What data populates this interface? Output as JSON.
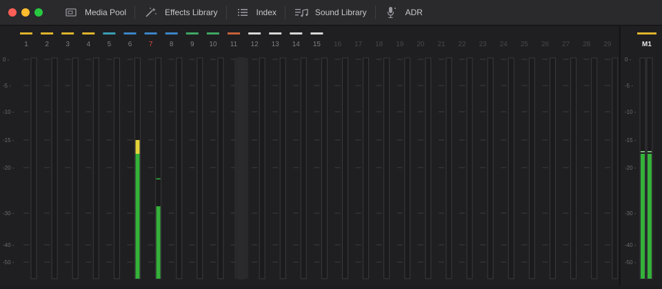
{
  "window": {
    "title": ""
  },
  "toolbar": {
    "items": [
      {
        "label": "Media Pool",
        "icon": "media-pool-icon"
      },
      {
        "label": "Effects Library",
        "icon": "effects-library-icon"
      },
      {
        "label": "Index",
        "icon": "index-icon"
      },
      {
        "label": "Sound Library",
        "icon": "sound-library-icon"
      },
      {
        "label": "ADR",
        "icon": "adr-microphone-icon"
      }
    ]
  },
  "meters": {
    "scale": [
      {
        "label": "0 -",
        "db": 0
      },
      {
        "label": "-5 -",
        "db": -5
      },
      {
        "label": "-10 -",
        "db": -10
      },
      {
        "label": "-15 -",
        "db": -15
      },
      {
        "label": "-20 -",
        "db": -20
      },
      {
        "label": "-30 -",
        "db": -30
      },
      {
        "label": "-40 -",
        "db": -40
      },
      {
        "label": "-50 -",
        "db": -50
      }
    ],
    "channels": [
      {
        "label": "1",
        "color": "#e0b52c",
        "active": true
      },
      {
        "label": "2",
        "color": "#e0b52c",
        "active": true
      },
      {
        "label": "3",
        "color": "#e0b52c",
        "active": true
      },
      {
        "label": "4",
        "color": "#e0b52c",
        "active": true
      },
      {
        "label": "5",
        "color": "#3aa0b8",
        "active": true
      },
      {
        "label": "6",
        "color": "#3c86c8",
        "active": true,
        "level": -17.5,
        "peak": -15,
        "hold": -15
      },
      {
        "label": "7",
        "color": "#3c86c8",
        "active": true,
        "selected": true,
        "level": -28.5,
        "hold": -22.5
      },
      {
        "label": "8",
        "color": "#3c86c8",
        "active": true
      },
      {
        "label": "9",
        "color": "#3fa863",
        "active": true
      },
      {
        "label": "10",
        "color": "#3fa863",
        "active": true
      },
      {
        "label": "11",
        "color": "#c8623a",
        "active": true,
        "disabled": true
      },
      {
        "label": "12",
        "color": "#d8d8d8",
        "active": true
      },
      {
        "label": "13",
        "color": "#d8d8d8",
        "active": true
      },
      {
        "label": "14",
        "color": "#d8d8d8",
        "active": true
      },
      {
        "label": "15",
        "color": "#d8d8d8",
        "active": true
      },
      {
        "label": "16",
        "active": false
      },
      {
        "label": "17",
        "active": false
      },
      {
        "label": "18",
        "active": false
      },
      {
        "label": "19",
        "active": false
      },
      {
        "label": "20",
        "active": false
      },
      {
        "label": "21",
        "active": false
      },
      {
        "label": "22",
        "active": false
      },
      {
        "label": "23",
        "active": false
      },
      {
        "label": "24",
        "active": false
      },
      {
        "label": "25",
        "active": false
      },
      {
        "label": "26",
        "active": false
      },
      {
        "label": "27",
        "active": false
      },
      {
        "label": "28",
        "active": false
      },
      {
        "label": "29",
        "active": false
      }
    ],
    "master": {
      "label": "M1",
      "color": "#e0b52c",
      "level": -17.5,
      "hold": -17.2
    }
  },
  "colors": {
    "meter_green": "#35b13a",
    "meter_yellow": "#e3d33a",
    "selected_label": "#e04a3a",
    "active_label": "#7f7f85",
    "inactive_label": "#48484c",
    "master_label": "#e6e6e6"
  }
}
